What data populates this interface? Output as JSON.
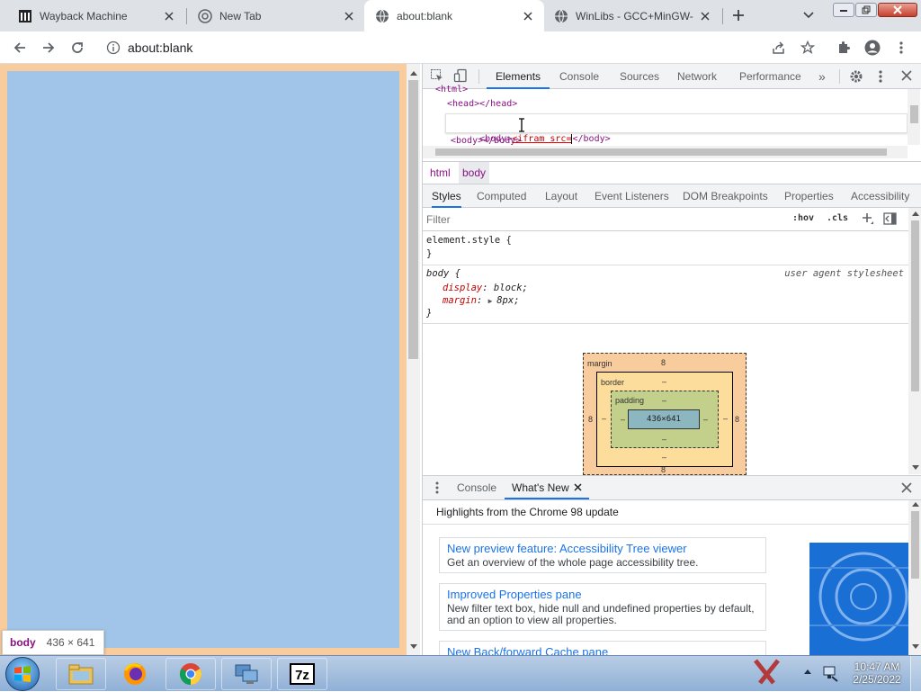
{
  "tabs": [
    {
      "title": "Wayback Machine",
      "active": false
    },
    {
      "title": "New Tab",
      "active": false
    },
    {
      "title": "about:blank",
      "active": true
    },
    {
      "title": "WinLibs - GCC+MinGW-",
      "active": false
    }
  ],
  "toolbar": {
    "url": "about:blank"
  },
  "tooltip": {
    "tag": "body",
    "size": "436 × 641"
  },
  "devtools": {
    "tabs": [
      "Elements",
      "Console",
      "Sources",
      "Network",
      "Performance"
    ],
    "more": "»",
    "elements": {
      "line0": "<html>",
      "line1": "<head></head>",
      "line2_prefix": "<body>",
      "line2_edit": "<ifram src=",
      "line2_suffix": "</body>",
      "line3": "<body></body>"
    },
    "breadcrumbs": [
      "html",
      "body"
    ],
    "styles_tabs": [
      "Styles",
      "Computed",
      "Layout",
      "Event Listeners",
      "DOM Breakpoints",
      "Properties",
      "Accessibility"
    ],
    "filter_placeholder": "Filter",
    "hov": ":hov",
    "cls": ".cls",
    "rules": {
      "element_style": "element.style {",
      "close": "}",
      "body_selector": "body {",
      "origin": "user agent stylesheet",
      "prop1": "display",
      "val1": "block;",
      "prop2": "margin",
      "val2": "8px;"
    },
    "boxmodel": {
      "margin_label": "margin",
      "margin_top": "8",
      "margin_left": "8",
      "margin_right": "8",
      "margin_bottom": "8",
      "border_label": "border",
      "border_val": "–",
      "padding_label": "padding",
      "padding_val": "–",
      "content": "436×641"
    },
    "drawer": {
      "tabs": [
        "Console",
        "What's New"
      ],
      "heading": "Highlights from the Chrome 98 update",
      "cards": [
        {
          "title": "New preview feature: Accessibility Tree viewer",
          "desc": "Get an overview of the whole page accessibility tree."
        },
        {
          "title": "Improved Properties pane",
          "desc": "New filter text box, hide null and undefined properties by default, and an option to view all properties."
        },
        {
          "title": "New Back/forward Cache pane",
          "desc": ""
        }
      ]
    }
  },
  "taskbar": {
    "time": "10:47 AM",
    "date": "2/25/2022"
  },
  "colors": {
    "page_margin": "#f9cc9d",
    "page_content": "#a0c5e8",
    "accent": "#1a73e8"
  }
}
